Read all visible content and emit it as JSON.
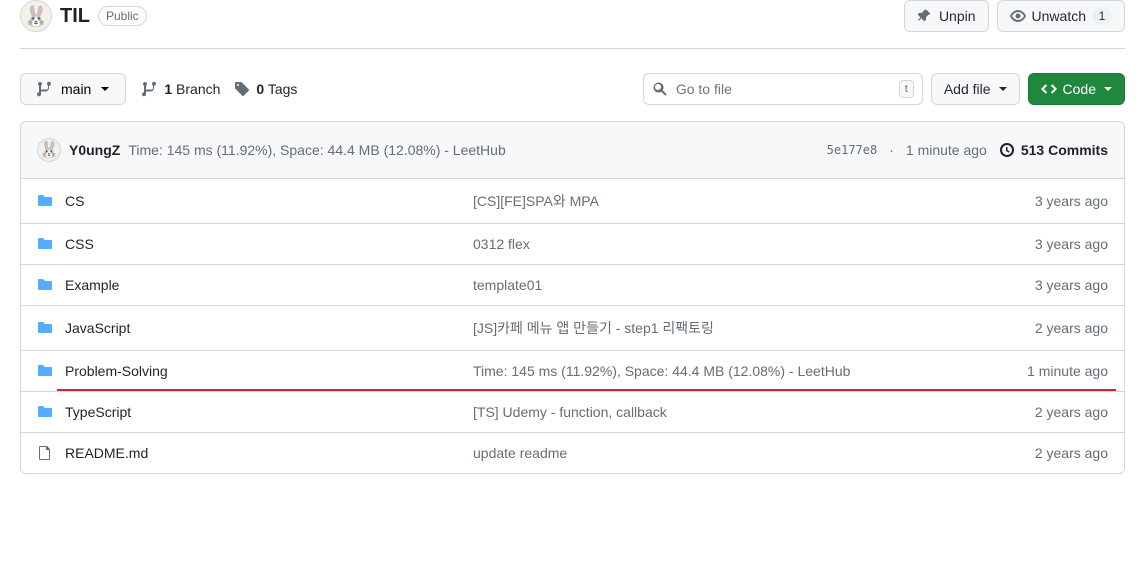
{
  "header": {
    "repo_name": "TIL",
    "visibility": "Public",
    "unpin_label": "Unpin",
    "unwatch_label": "Unwatch",
    "unwatch_count": "1"
  },
  "nav": {
    "branch_name": "main",
    "branches_count": "1",
    "branches_label": "Branch",
    "tags_count": "0",
    "tags_label": "Tags",
    "search_placeholder": "Go to file",
    "search_kbd": "t",
    "addfile_label": "Add file",
    "code_label": "Code"
  },
  "commit": {
    "author": "Y0ungZ",
    "message": "Time: 145 ms (11.92%), Space: 44.4 MB (12.08%) - LeetHub",
    "sha": "5e177e8",
    "time": "1 minute ago",
    "commits_count": "513",
    "commits_label": "Commits"
  },
  "files": [
    {
      "type": "folder",
      "name": "CS",
      "message": "[CS][FE]SPA와 MPA",
      "time": "3 years ago",
      "highlighted": false
    },
    {
      "type": "folder",
      "name": "CSS",
      "message": "0312 flex",
      "time": "3 years ago",
      "highlighted": false
    },
    {
      "type": "folder",
      "name": "Example",
      "message": "template01",
      "time": "3 years ago",
      "highlighted": false
    },
    {
      "type": "folder",
      "name": "JavaScript",
      "message": "[JS]카페 메뉴 앱 만들기 - step1 리팩토링",
      "time": "2 years ago",
      "highlighted": false
    },
    {
      "type": "folder",
      "name": "Problem-Solving",
      "message": "Time: 145 ms (11.92%), Space: 44.4 MB (12.08%) - LeetHub",
      "time": "1 minute ago",
      "highlighted": true
    },
    {
      "type": "folder",
      "name": "TypeScript",
      "message": "[TS] Udemy - function, callback",
      "time": "2 years ago",
      "highlighted": false
    },
    {
      "type": "file",
      "name": "README.md",
      "message": "update readme",
      "time": "2 years ago",
      "highlighted": false
    }
  ]
}
